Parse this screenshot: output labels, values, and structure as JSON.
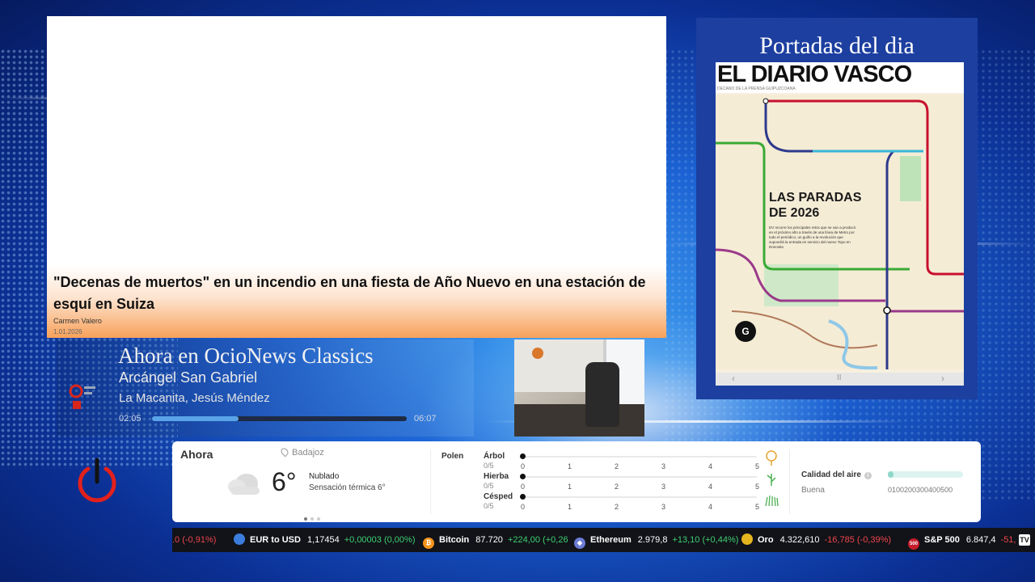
{
  "news": {
    "headline": "\"Decenas de muertos\" en un incendio en una fiesta de Año Nuevo en una estación de esquí en Suiza",
    "author": "Carmen Valero",
    "date": "1.01.2026"
  },
  "radio": {
    "title": "Ahora en OcioNews Classics",
    "song": "Arcángel San Gabriel",
    "artist": "La Macanita, Jesús Méndez",
    "elapsed": "02:05",
    "total": "06:07",
    "progress": 0.34
  },
  "papers": {
    "title": "Portadas del dia",
    "masthead": "EL DIARIO VASCO",
    "subtitle": "DECANO DE LA PRENSA GUIPUZCOANA",
    "headline_line1": "LAS PARADAS",
    "headline_line2": "DE 2026",
    "body": "DV recorre los principales retos que se van a producir en el próximo año a través de una línea de Metro por todo el periódico, un guiño a la revolución que supondrá la entrada en servicio del nuevo Topo en Donostia",
    "badge": "G",
    "nav_prev": "‹",
    "nav_mid": "II",
    "nav_next": "›"
  },
  "weather": {
    "now_label": "Ahora",
    "location": "Badajoz",
    "temperature": "6°",
    "condition": "Nublado",
    "feels_like": "Sensación térmica 6°",
    "polen_label": "Polen",
    "polen": [
      {
        "name": "Árbol",
        "value": "0/5",
        "level": 0
      },
      {
        "name": "Hierba",
        "value": "0/5",
        "level": 0
      },
      {
        "name": "Césped",
        "value": "0/5",
        "level": 0
      }
    ],
    "polen_scale": [
      "0",
      "1",
      "2",
      "3",
      "4",
      "5"
    ],
    "air_title": "Calidad del aire",
    "air_info": "i",
    "air_status": "Buena",
    "air_scale": "0100200300400500",
    "air_level": 0.08,
    "page_dots": 3,
    "active_dot": 0
  },
  "ticker": {
    "items": [
      {
        "name": "",
        "price": "",
        "change": ".0 (-0,91%)",
        "dir": "neg",
        "icon": "none",
        "color": "#111318"
      },
      {
        "name": "EUR to USD",
        "price": "1,17454",
        "change": "+0,00003 (0,00%)",
        "dir": "pos",
        "icon": "euro-dollar-icon",
        "color": "#3b7ddd"
      },
      {
        "name": "Bitcoin",
        "price": "87.720",
        "change": "+224,00 (+0,26",
        "dir": "pos",
        "icon": "bitcoin-icon",
        "color": "#f7931a"
      },
      {
        "name": "Ethereum",
        "price": "2.979,8",
        "change": "+13,10 (+0,44%)",
        "dir": "pos",
        "icon": "ethereum-icon",
        "color": "#6b7bd6"
      },
      {
        "name": "Oro",
        "price": "4.322,610",
        "change": "-16,785 (-0,39%)",
        "dir": "neg",
        "icon": "gold-icon",
        "color": "#e4b51e"
      },
      {
        "name": "S&P 500",
        "price": "6.847,4",
        "change": "-51,",
        "dir": "neg",
        "icon": "sp500-icon",
        "color": "#c41c2b"
      }
    ],
    "icon_labels": {
      "bitcoin": "₿",
      "ethereum": "◆",
      "sp500": "500"
    },
    "brand": "TV"
  }
}
